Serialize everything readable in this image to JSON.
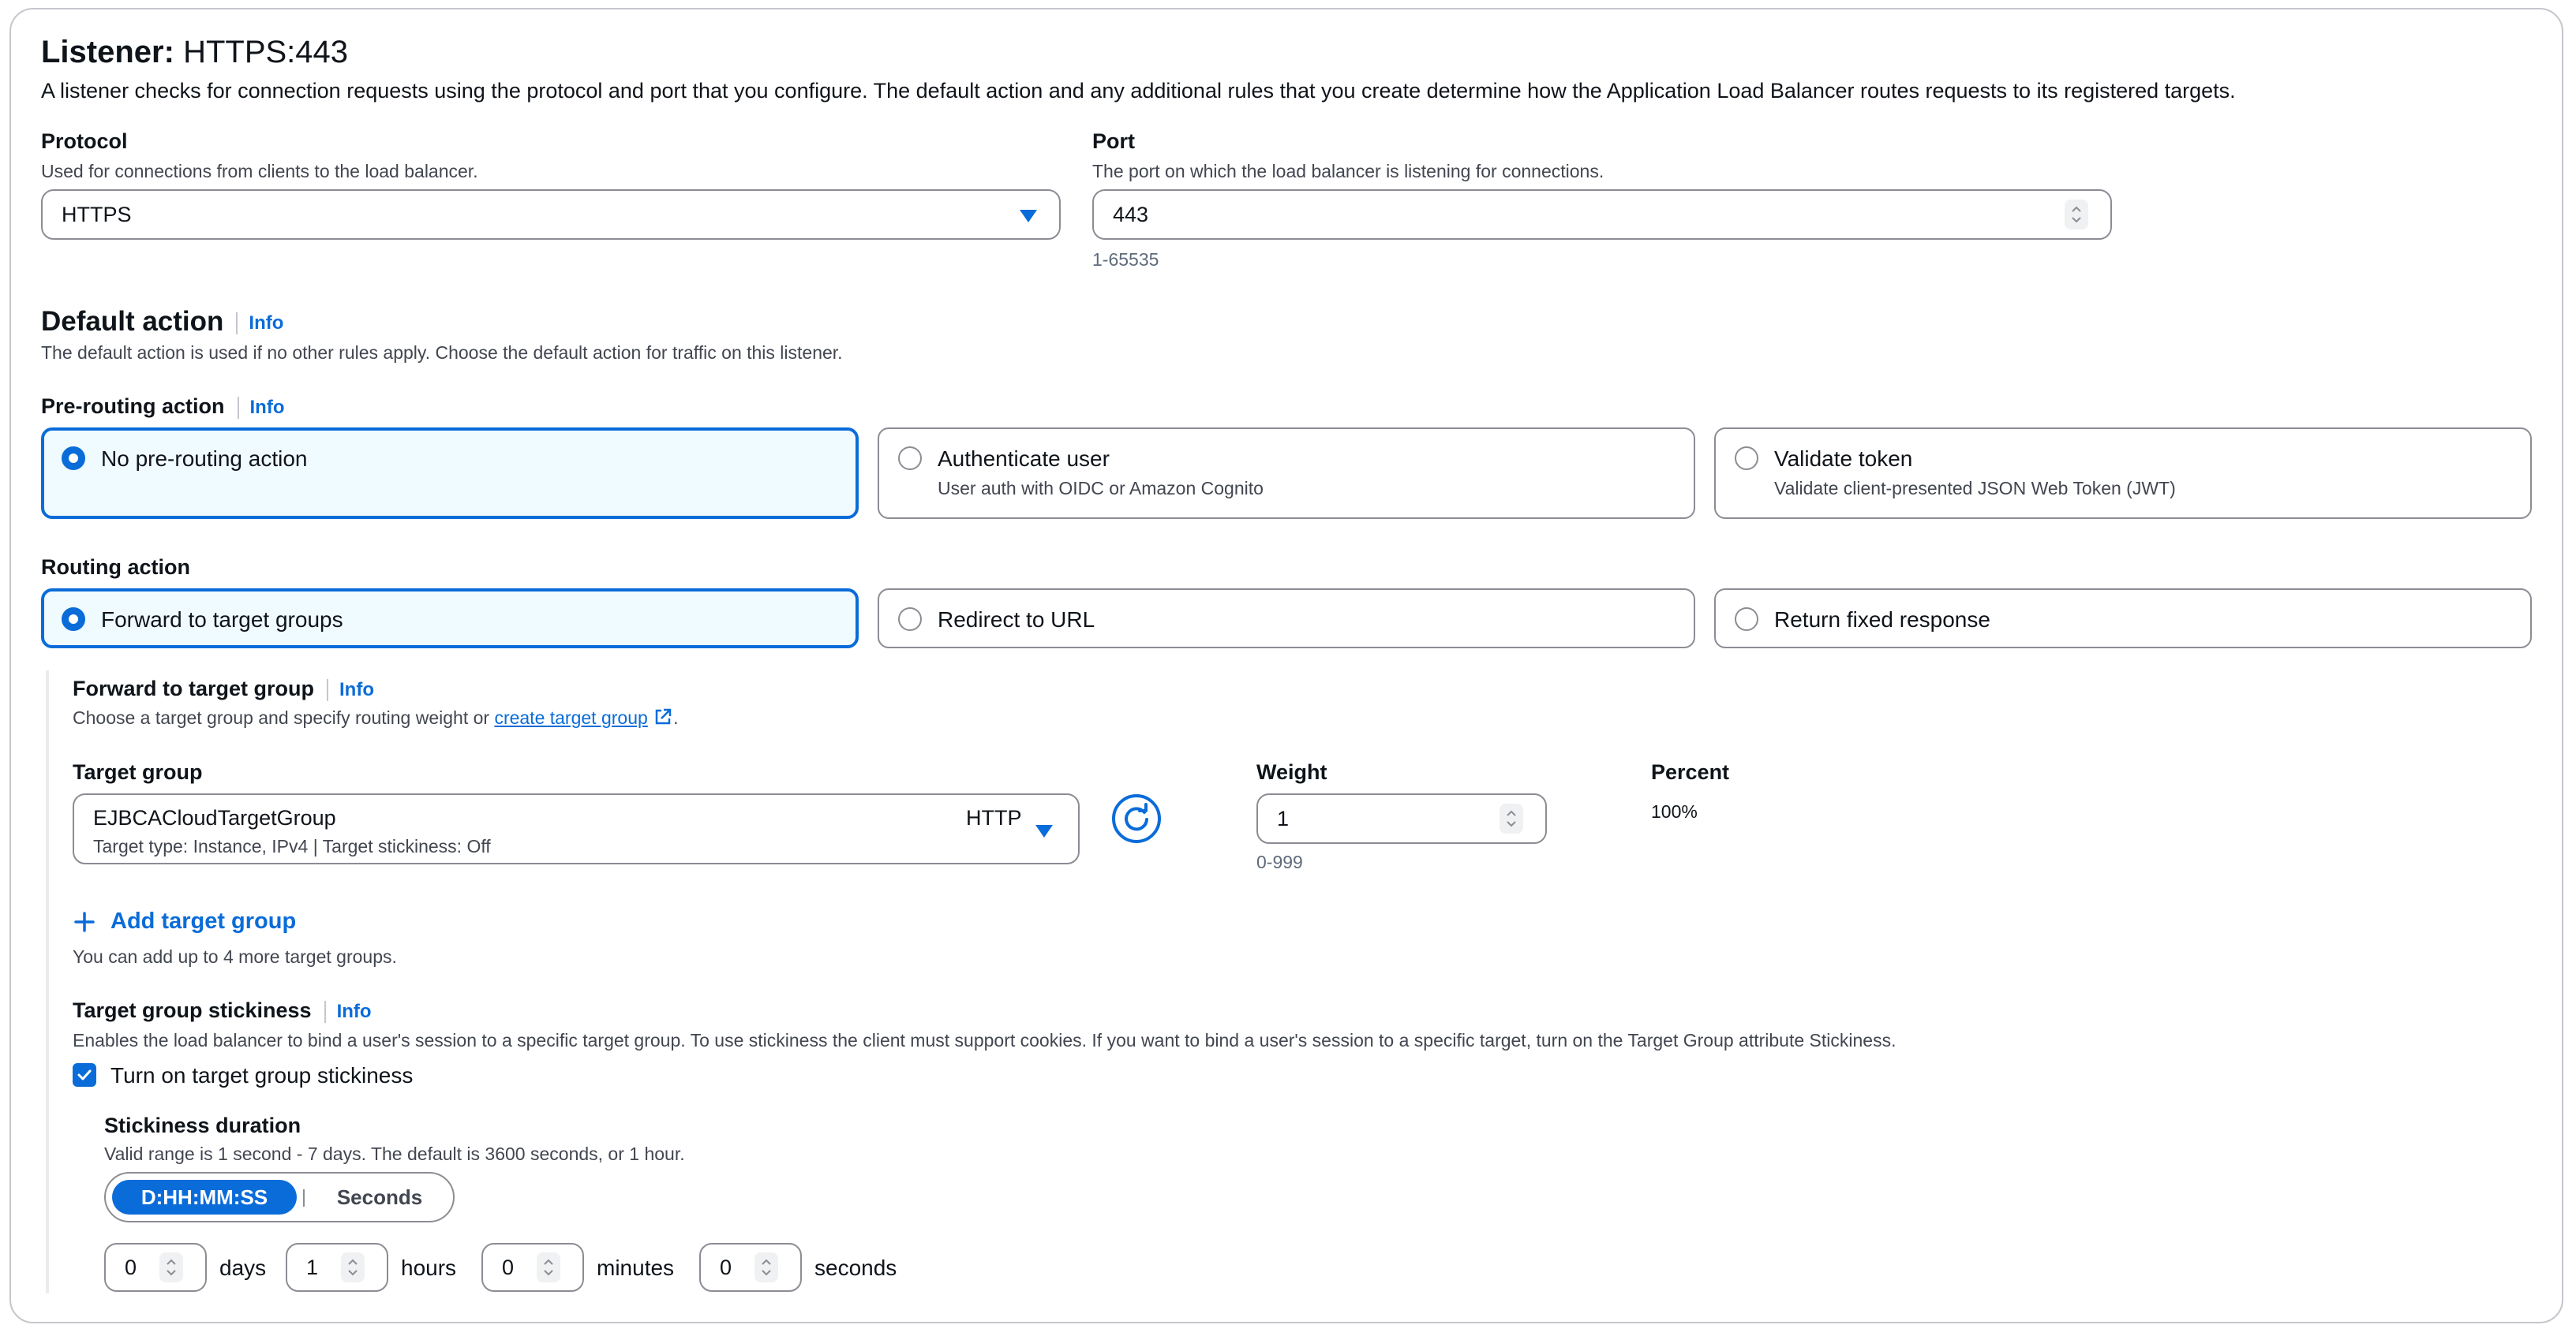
{
  "listener": {
    "title_prefix": "Listener:",
    "title_value": "HTTPS:443",
    "description": "A listener checks for connection requests using the protocol and port that you configure. The default action and any additional rules that you create determine how the Application Load Balancer routes requests to its registered targets."
  },
  "protocol": {
    "label": "Protocol",
    "description": "Used for connections from clients to the load balancer.",
    "value": "HTTPS"
  },
  "port": {
    "label": "Port",
    "description": "The port on which the load balancer is listening for connections.",
    "value": "443",
    "constraint": "1-65535"
  },
  "default_action": {
    "title": "Default action",
    "info": "Info",
    "description": "The default action is used if no other rules apply. Choose the default action for traffic on this listener."
  },
  "pre_routing": {
    "title": "Pre-routing action",
    "info": "Info",
    "options": [
      {
        "label": "No pre-routing action",
        "description": "",
        "selected": true
      },
      {
        "label": "Authenticate user",
        "description": "User auth with OIDC or Amazon Cognito",
        "selected": false
      },
      {
        "label": "Validate token",
        "description": "Validate client-presented JSON Web Token (JWT)",
        "selected": false
      }
    ]
  },
  "routing": {
    "title": "Routing action",
    "options": [
      {
        "label": "Forward to target groups",
        "selected": true
      },
      {
        "label": "Redirect to URL",
        "selected": false
      },
      {
        "label": "Return fixed response",
        "selected": false
      }
    ]
  },
  "forward": {
    "title": "Forward to target group",
    "info": "Info",
    "description_prefix": "Choose a target group and specify routing weight or ",
    "link": "create target group",
    "description_suffix": "."
  },
  "target_group": {
    "label": "Target group",
    "name": "EJBCACloudTargetGroup",
    "protocol": "HTTP",
    "details": "Target type: Instance, IPv4 | Target stickiness: Off",
    "weight_label": "Weight",
    "weight": "1",
    "weight_constraint": "0-999",
    "percent_label": "Percent",
    "percent": "100%",
    "add_label": "Add target group",
    "add_hint": "You can add up to 4 more target groups."
  },
  "stickiness": {
    "title": "Target group stickiness",
    "info": "Info",
    "description": "Enables the load balancer to bind a user's session to a specific target group. To use stickiness the client must support cookies. If you want to bind a user's session to a specific target, turn on the Target Group attribute Stickiness.",
    "checkbox_label": "Turn on target group stickiness",
    "checked": true,
    "duration_title": "Stickiness duration",
    "duration_description": "Valid range is 1 second - 7 days. The default is 3600 seconds, or 1 hour.",
    "format_options": [
      "D:HH:MM:SS",
      "Seconds"
    ],
    "days": "0",
    "days_label": "days",
    "hours": "1",
    "hours_label": "hours",
    "minutes": "0",
    "minutes_label": "minutes",
    "seconds": "0",
    "seconds_label": "seconds"
  },
  "colors": {
    "accent": "#0a6cd9",
    "border": "#8c8c94",
    "selected_bg": "#f0fbff"
  }
}
